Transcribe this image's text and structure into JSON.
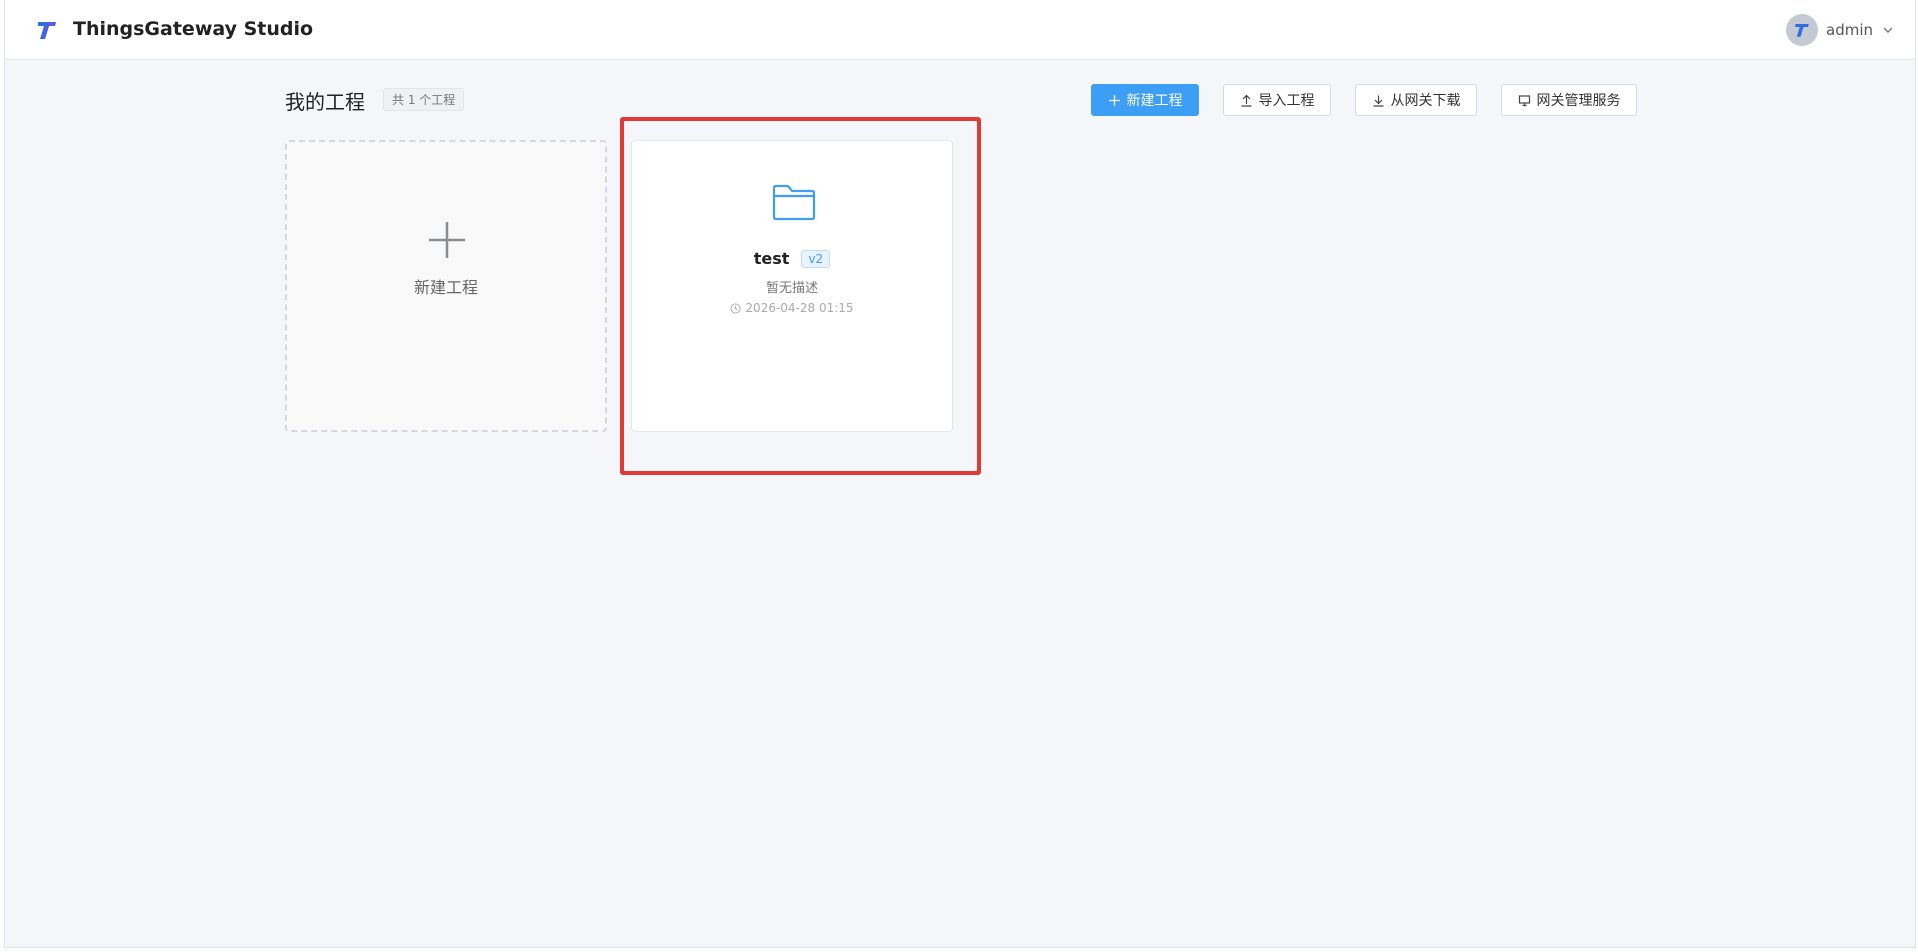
{
  "header": {
    "app_title": "ThingsGateway Studio",
    "username": "admin"
  },
  "main": {
    "title": "我的工程",
    "count_badge": "共 1 个工程"
  },
  "toolbar": {
    "new_project": "新建工程",
    "import_project": "导入工程",
    "download_from_gateway": "从网关下载",
    "gateway_management": "网关管理服务"
  },
  "cards": {
    "new_card_label": "新建工程",
    "project": {
      "name": "test",
      "version": "v2",
      "description": "暂无描述",
      "updated": "2026-04-28 01:15"
    }
  },
  "colors": {
    "primary": "#3d9ef5",
    "background": "#f4f6fa",
    "highlight": "#e53935"
  },
  "icons": {
    "logo": "logo-icon",
    "avatar": "avatar-icon",
    "chevron": "chevron-down-icon",
    "plus": "plus-icon",
    "upload": "upload-icon",
    "download": "download-icon",
    "monitor": "monitor-icon",
    "folder": "folder-icon",
    "clock": "clock-icon"
  }
}
